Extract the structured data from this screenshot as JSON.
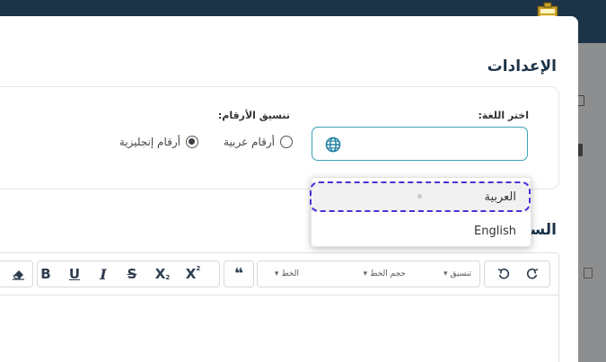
{
  "header": {
    "logo_icon": "exam-logo-icon"
  },
  "modal": {
    "settings_title": "الإعدادات",
    "language": {
      "label": "اختر اللغة:",
      "icon": "globe-icon",
      "options": [
        "العربية",
        "English"
      ],
      "hovered_option": "العربية"
    },
    "numbers": {
      "label": "تنسيق الأرقام:",
      "options": [
        {
          "label": "أرقام عربية",
          "checked": false
        },
        {
          "label": "أرقام إنجليزية",
          "checked": true
        }
      ]
    },
    "question_title": "السؤال"
  },
  "editor": {
    "toolbar": {
      "format_label": "تنسيق",
      "font_size_label": "حجم الخط",
      "font_label": "الخط",
      "bold": "B",
      "underline": "U",
      "italic": "I",
      "strike": "S",
      "subscript": "X",
      "superscript": "X",
      "quote": "❝"
    }
  },
  "colors": {
    "header_bg": "#1c3348",
    "focus_ring": "#4b2fd6",
    "input_border": "#3aa3b8",
    "title_text": "#1c3348"
  }
}
